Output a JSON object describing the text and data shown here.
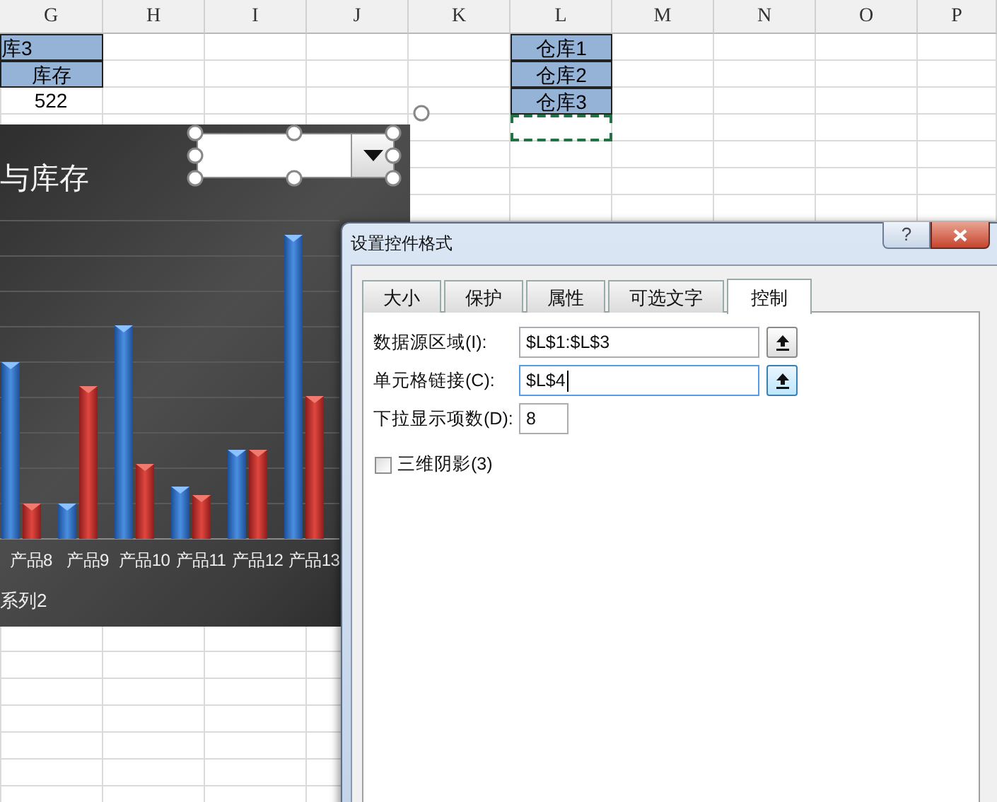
{
  "sheet": {
    "columns": [
      "G",
      "H",
      "I",
      "J",
      "K",
      "L",
      "M",
      "N",
      "O",
      "P"
    ],
    "rows": [
      {
        "G": {
          "text": "库3",
          "filled": true
        },
        "L": {
          "text": "仓库1",
          "filled": true
        }
      },
      {
        "G": {
          "text": "库存",
          "filled": true
        },
        "L": {
          "text": "仓库2",
          "filled": true
        }
      },
      {
        "G": {
          "text": "522",
          "filled": false
        },
        "L": {
          "text": "仓库3",
          "filled": true
        }
      },
      {
        "L": {
          "marquee": true
        }
      }
    ]
  },
  "chart": {
    "title": "与库存",
    "combo_box": {
      "selected": true
    },
    "categories": [
      "产品8",
      "产品9",
      "产品10",
      "产品11",
      "产品12",
      "产品13"
    ],
    "legend": "系列2"
  },
  "dialog": {
    "title": "设置控件格式",
    "help": "?",
    "tabs": [
      {
        "label": "大小",
        "selected": false
      },
      {
        "label": "保护",
        "selected": false
      },
      {
        "label": "属性",
        "selected": false
      },
      {
        "label": "可选文字",
        "selected": false
      },
      {
        "label": "控制",
        "selected": true
      }
    ],
    "fields": [
      {
        "label": "数据源区域(I):",
        "value": "$L$1:$L$3",
        "kind": "reference",
        "focused": false
      },
      {
        "label": "单元格链接(C):",
        "value": "$L$4",
        "kind": "reference",
        "focused": true
      },
      {
        "label": "下拉显示项数(D):",
        "value": "8",
        "kind": "number",
        "focused": false
      }
    ],
    "checkbox": {
      "label": "三维阴影(3)",
      "checked": false
    }
  }
}
